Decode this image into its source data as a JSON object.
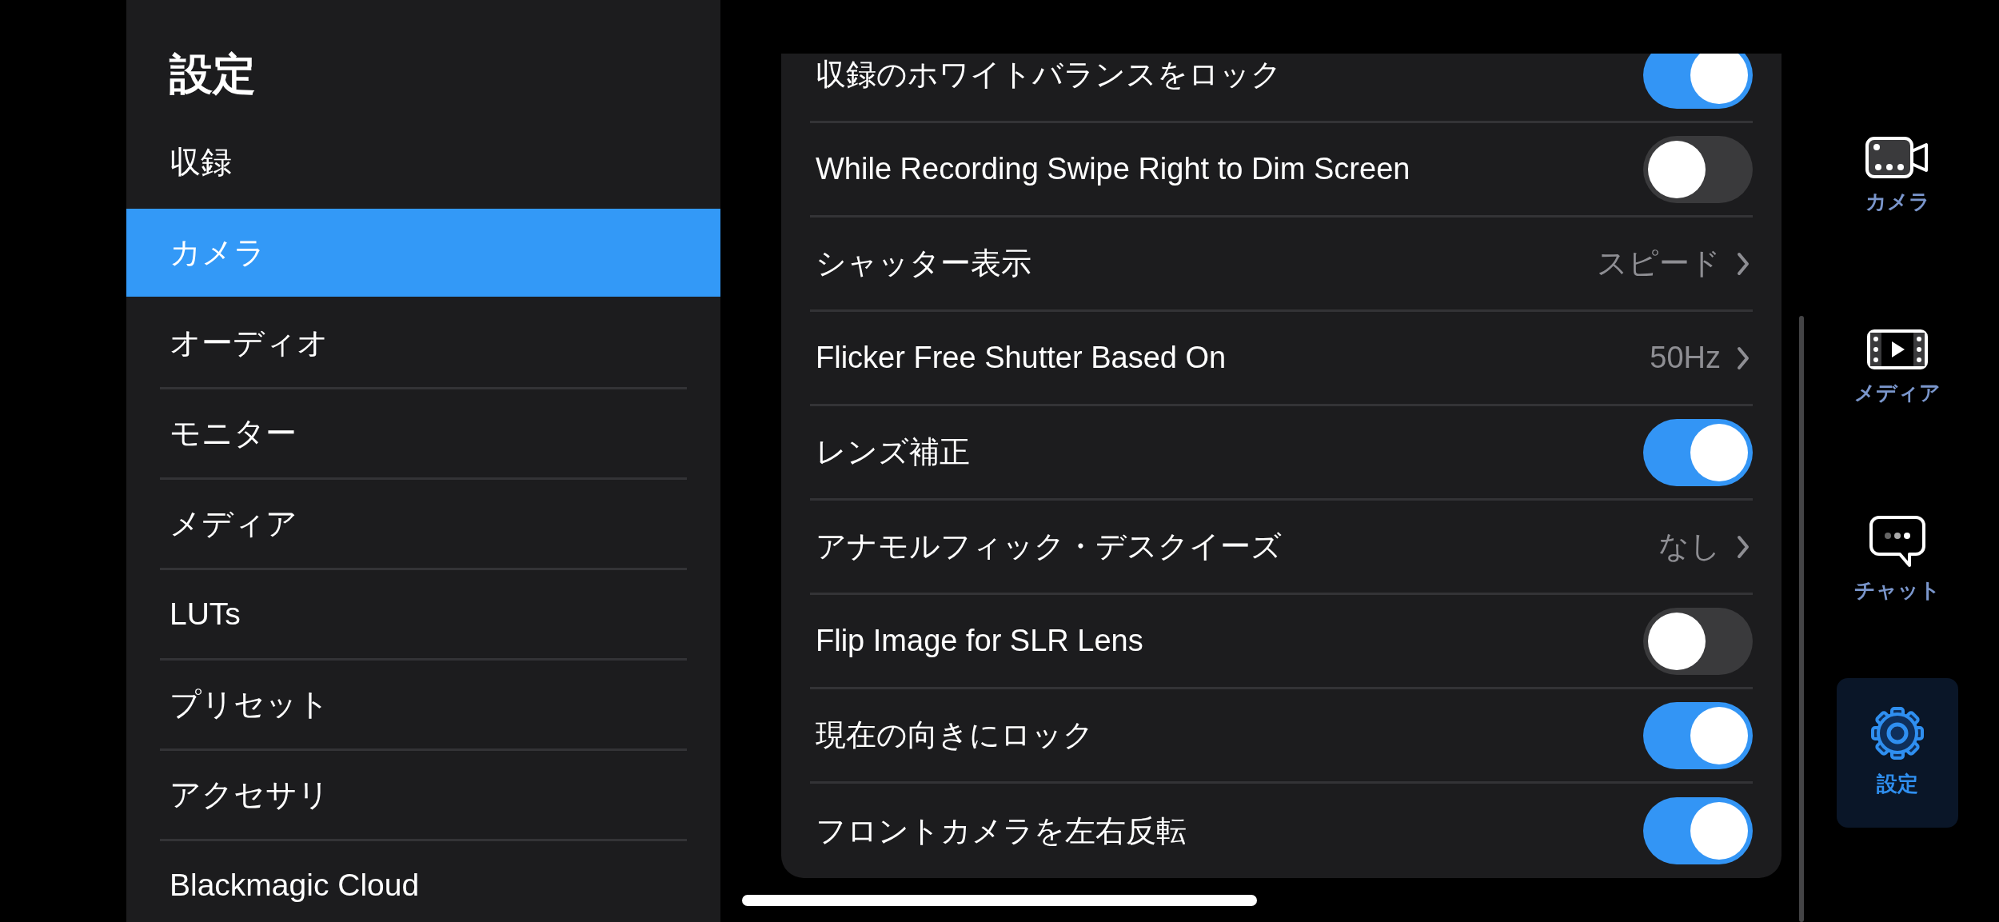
{
  "sidebar": {
    "title": "設定",
    "items": [
      {
        "label": "収録",
        "selected": false
      },
      {
        "label": "カメラ",
        "selected": true
      },
      {
        "label": "オーディオ",
        "selected": false
      },
      {
        "label": "モニター",
        "selected": false
      },
      {
        "label": "メディア",
        "selected": false
      },
      {
        "label": "LUTs",
        "selected": false
      },
      {
        "label": "プリセット",
        "selected": false
      },
      {
        "label": "アクセサリ",
        "selected": false
      },
      {
        "label": "Blackmagic Cloud",
        "selected": false
      }
    ]
  },
  "settings": [
    {
      "kind": "toggle",
      "label": "収録のホワイトバランスをロック",
      "on": true
    },
    {
      "kind": "toggle",
      "label": "While Recording Swipe Right to Dim Screen",
      "on": false
    },
    {
      "kind": "value",
      "label": "シャッター表示",
      "value": "スピード"
    },
    {
      "kind": "value",
      "label": "Flicker Free Shutter Based On",
      "value": "50Hz"
    },
    {
      "kind": "toggle",
      "label": "レンズ補正",
      "on": true
    },
    {
      "kind": "value",
      "label": "アナモルフィック・デスクイーズ",
      "value": "なし"
    },
    {
      "kind": "toggle",
      "label": "Flip Image for SLR Lens",
      "on": false
    },
    {
      "kind": "toggle",
      "label": "現在の向きにロック",
      "on": true
    },
    {
      "kind": "toggle",
      "label": "フロントカメラを左右反転",
      "on": true
    }
  ],
  "nav": [
    {
      "label": "カメラ",
      "selected": false
    },
    {
      "label": "メディア",
      "selected": false
    },
    {
      "label": "チャット",
      "selected": false
    },
    {
      "label": "設定",
      "selected": true
    }
  ]
}
